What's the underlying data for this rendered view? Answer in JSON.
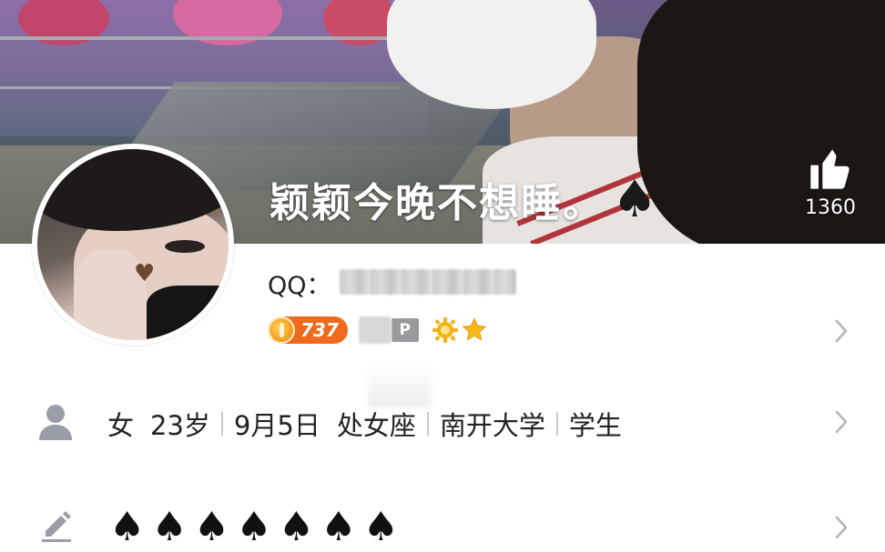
{
  "cover": {
    "nickname": "颖颖今晚不想睡。",
    "nickname_suffix": "♠",
    "like_icon": "thumbs-up-icon",
    "like_count": "1360"
  },
  "profile": {
    "avatar": "avatar",
    "qq_label": "QQ：",
    "qq_number_obscured": true,
    "level_value": "737",
    "vip_badge": "P",
    "level_icons": [
      "sun-gear-icon",
      "star-icon"
    ]
  },
  "info": {
    "person_icon": "person-icon",
    "gender": "女",
    "age": "23岁",
    "birthday": "9月5日",
    "zodiac": "处女座",
    "school": "南开大学",
    "occupation": "学生"
  },
  "signature": {
    "edit_icon": "pencil-icon",
    "spades": [
      "♠",
      "♠",
      "♠",
      "♠",
      "♠",
      "♠",
      "♠"
    ]
  },
  "colors": {
    "level_badge": "#f06a1d",
    "chevron": "#b5b5b9",
    "icon_grey": "#9a9ca8"
  }
}
